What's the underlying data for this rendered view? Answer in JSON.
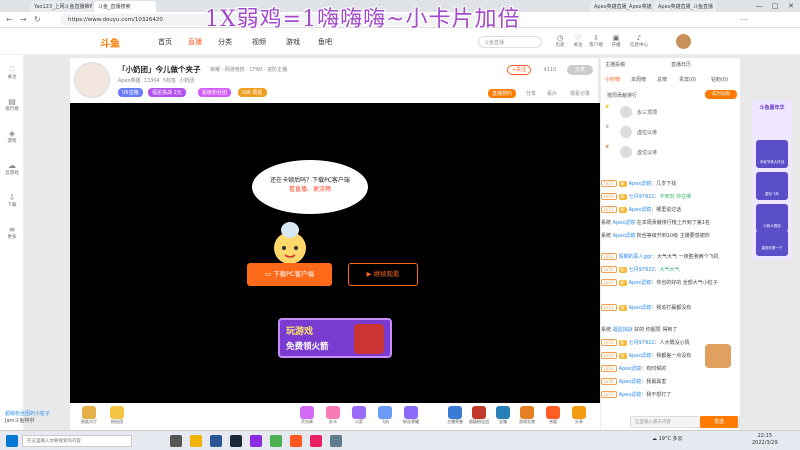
{
  "browser": {
    "tabs": [
      {
        "label": "Yao123_上网斗鱼直播推荐"
      },
      {
        "label": "斗鱼_直播搜索"
      },
      {
        "label": "Apex英雄直播_Apex英雄"
      },
      {
        "label": "Apex英雄直播_斗鱼直播"
      },
      {
        "label": "Apex英雄直播_斗鱼直播"
      }
    ],
    "url": "https://www.douyu.com/10326420",
    "window_controls": [
      "—",
      "□",
      "✕"
    ]
  },
  "overlay_title": "1X弱鸡=1嗨嗨嗨~小卡片加倍",
  "site": {
    "logo": "斗鱼",
    "nav": [
      "首页",
      "直播",
      "分类",
      "视频",
      "游戏",
      "鱼吧"
    ],
    "active_nav": "直播",
    "search_placeholder": "斗鱼直播",
    "header_icons": [
      "历史",
      "关注",
      "客户端",
      "开播",
      "信息中心"
    ]
  },
  "left_sidebar": [
    "关注",
    "排行榜",
    "游戏",
    "云游戏",
    "下载",
    "更多"
  ],
  "streamer": {
    "room_title": "「小奶团」今儿做个夹子",
    "tags": [
      "荣耀",
      "网游竞技",
      "CF60",
      "进阶主播"
    ],
    "name": "Apex英雄",
    "stats": [
      "13304",
      "5标签",
      "小奶团"
    ],
    "badges": [
      "V6宝箱",
      "福星挑战 2元",
      "超级粉丝团",
      "Gift 周星"
    ],
    "follow_label": "+关注",
    "follow_count": "4110",
    "share_label": "分享",
    "sub_actions": [
      "直播预约",
      "分享",
      "看片",
      "观看记录"
    ]
  },
  "video": {
    "bubble_line1": "还在卡顿后吗？下载PC客户端",
    "bubble_line2": "看直播、更流畅",
    "download_btn": "下载PC客户端",
    "continue_btn": "继续观看",
    "game_line1": "玩游戏",
    "game_line2": "免费领火箭"
  },
  "gifts": [
    "贵族大厅",
    "粉丝团",
    "荧光棒",
    "办卡",
    "火箭",
    "飞机",
    "粉丝荣耀",
    "主播荣誉",
    "超级粉丝团",
    "宝箱",
    "游戏礼物",
    "充值",
    "分享"
  ],
  "right_panel": {
    "top_tabs": [
      "主播投稿",
      "直播日历"
    ],
    "tabs": [
      "小时榜",
      "本周榜",
      "总榜",
      "贵宾(0)",
      "钻粉(0)"
    ],
    "rank_title": "按周贡献排行",
    "rank_btn": "成为钻粉",
    "ranks": [
      {
        "name": "永三顶顶"
      },
      {
        "name": "虚位以待"
      },
      {
        "name": "虚位以待"
      }
    ],
    "chat": [
      {
        "lv": "LV27",
        "user": "Apex滤镜",
        "text": "几岁下找"
      },
      {
        "lv": "LV37",
        "user": "七月97922",
        "text": "不到刻 你在哪"
      },
      {
        "lv": "LV11",
        "user": "Apex滤镜",
        "text": "哪里说过话"
      },
      {
        "lv": "系统",
        "user": "Apex滤镜",
        "text": "在本周贡献排行榜上升到了第1名"
      },
      {
        "lv": "系统",
        "user": "Apex滤镜",
        "text": "粉丝等级升到10级 主播要感谢你"
      },
      {
        "lv": "LV11",
        "user": "假期的恶人ggr",
        "text": "大气大气 一夜胜我两个飞机"
      },
      {
        "lv": "LV35",
        "user": "七月97922",
        "text": "大气大气"
      },
      {
        "lv": "LV37",
        "user": "Apex滤镜",
        "text": "你也的好的 全部大气小粒子"
      },
      {
        "lv": "LV11",
        "user": "Apex滤镜",
        "text": "我追打赢都没有"
      },
      {
        "lv": "系统",
        "user": "福星挑战",
        "text": "好的 你超赞 得到了"
      },
      {
        "lv": "LV35",
        "user": "七月97922",
        "text": "人大概没心情"
      },
      {
        "lv": "LV37",
        "user": "Apex滤镜",
        "text": "我都差一点没有"
      },
      {
        "lv": "LV11",
        "user": "Apex滤镜",
        "text": "有时候的"
      },
      {
        "lv": "LV35",
        "user": "Apex滤镜",
        "text": "我最属害"
      },
      {
        "lv": "LV37",
        "user": "Apex滤镜",
        "text": "我不想打了"
      }
    ],
    "chat_placeholder": "这里输入聊天内容",
    "send_label": "发送"
  },
  "promo": {
    "title": "斗鱼嘉年华",
    "items": [
      "中秋节夜大作战",
      "星际飞车",
      "小新大冒险",
      "星期天看一下"
    ]
  },
  "bottom_left": "超级粉丝团的小粒子",
  "bottom_left2": "Jam斗鱼特供",
  "taskbar": {
    "search": "在这里输入你要搜索的内容",
    "weather": "19°C 多云",
    "time": "22:15",
    "date": "2022/3/29"
  }
}
